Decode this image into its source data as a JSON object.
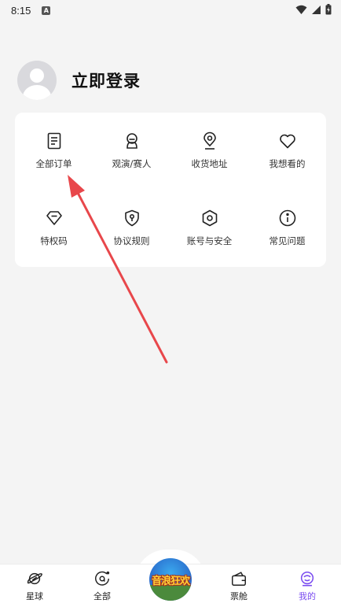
{
  "status": {
    "time": "8:15",
    "notif_letter": "A"
  },
  "profile": {
    "login_text": "立即登录"
  },
  "menu": {
    "items": [
      {
        "label": "全部订单",
        "icon": "document-icon"
      },
      {
        "label": "观演/赛人",
        "icon": "person-icon"
      },
      {
        "label": "收货地址",
        "icon": "location-pin-icon"
      },
      {
        "label": "我想看的",
        "icon": "heart-icon"
      },
      {
        "label": "特权码",
        "icon": "diamond-icon"
      },
      {
        "label": "协议规则",
        "icon": "shield-icon"
      },
      {
        "label": "账号与安全",
        "icon": "hexagon-icon"
      },
      {
        "label": "常见问题",
        "icon": "info-icon"
      }
    ]
  },
  "tabbar": {
    "tabs": [
      {
        "label": "星球",
        "icon": "planet-icon"
      },
      {
        "label": "全部",
        "icon": "all-icon"
      },
      {
        "label": "票舱",
        "icon": "ticket-wallet-icon"
      },
      {
        "label": "我的",
        "icon": "profile-face-icon",
        "active": true
      }
    ],
    "center_badge_text": "音浪狂欢"
  },
  "colors": {
    "accent": "#7a4cf0",
    "arrow": "#e8474b",
    "card": "#ffffff",
    "background": "#f4f4f4"
  }
}
